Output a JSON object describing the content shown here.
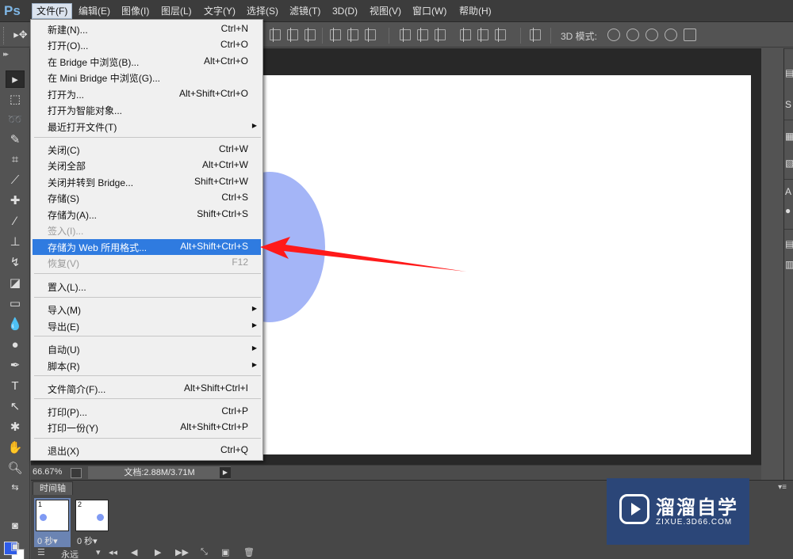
{
  "app": {
    "logo": "Ps"
  },
  "menubar": {
    "items": [
      "文件(F)",
      "编辑(E)",
      "图像(I)",
      "图层(L)",
      "文字(Y)",
      "选择(S)",
      "滤镜(T)",
      "3D(D)",
      "视图(V)",
      "窗口(W)",
      "帮助(H)"
    ],
    "active_index": 0
  },
  "optionsbar": {
    "mode_3d_label": "3D 模式:"
  },
  "file_menu": {
    "items": [
      {
        "label": "新建(N)...",
        "shortcut": "Ctrl+N"
      },
      {
        "label": "打开(O)...",
        "shortcut": "Ctrl+O"
      },
      {
        "label": "在 Bridge 中浏览(B)...",
        "shortcut": "Alt+Ctrl+O"
      },
      {
        "label": "在 Mini Bridge 中浏览(G)...",
        "shortcut": ""
      },
      {
        "label": "打开为...",
        "shortcut": "Alt+Shift+Ctrl+O"
      },
      {
        "label": "打开为智能对象...",
        "shortcut": ""
      },
      {
        "label": "最近打开文件(T)",
        "shortcut": "",
        "submenu": true
      },
      {
        "label": "关闭(C)",
        "shortcut": "Ctrl+W"
      },
      {
        "label": "关闭全部",
        "shortcut": "Alt+Ctrl+W"
      },
      {
        "label": "关闭并转到 Bridge...",
        "shortcut": "Shift+Ctrl+W"
      },
      {
        "label": "存储(S)",
        "shortcut": "Ctrl+S"
      },
      {
        "label": "存储为(A)...",
        "shortcut": "Shift+Ctrl+S"
      },
      {
        "label": "签入(I)...",
        "shortcut": "",
        "disabled": true
      },
      {
        "label": "存储为 Web 所用格式...",
        "shortcut": "Alt+Shift+Ctrl+S",
        "highlighted": true
      },
      {
        "label": "恢复(V)",
        "shortcut": "F12",
        "disabled": true
      },
      {
        "label": "置入(L)...",
        "shortcut": ""
      },
      {
        "label": "导入(M)",
        "shortcut": "",
        "submenu": true
      },
      {
        "label": "导出(E)",
        "shortcut": "",
        "submenu": true
      },
      {
        "label": "自动(U)",
        "shortcut": "",
        "submenu": true
      },
      {
        "label": "脚本(R)",
        "shortcut": "",
        "submenu": true
      },
      {
        "label": "文件简介(F)...",
        "shortcut": "Alt+Shift+Ctrl+I"
      },
      {
        "label": "打印(P)...",
        "shortcut": "Ctrl+P"
      },
      {
        "label": "打印一份(Y)",
        "shortcut": "Alt+Shift+Ctrl+P"
      },
      {
        "label": "退出(X)",
        "shortcut": "Ctrl+Q"
      }
    ]
  },
  "status": {
    "zoom": "66.67%",
    "doc_info": "文档:2.88M/3.71M"
  },
  "timeline": {
    "tab_label": "时间轴",
    "frames": [
      {
        "number": "1",
        "time": "0 秒▾"
      },
      {
        "number": "2",
        "time": "0 秒▾"
      }
    ],
    "loop": "永远"
  },
  "watermark": {
    "title": "溜溜自学",
    "url": "ZIXUE.3D66.COM"
  },
  "colors": {
    "foreground": "#2f5ce8",
    "background": "#ffffff",
    "highlight": "#2f7be0",
    "arrow": "#ff1a1a"
  }
}
